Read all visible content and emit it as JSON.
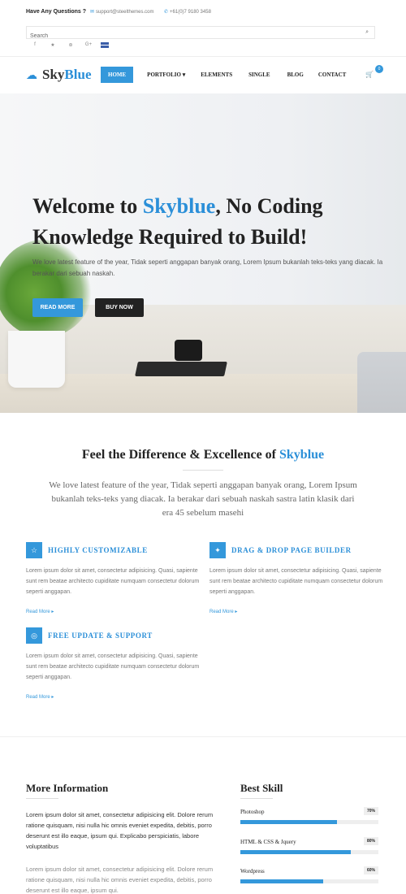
{
  "topbar": {
    "question": "Have Any Questions ?",
    "email": "support@steelthemes.com",
    "phone": "+61(0)7 9180 3458"
  },
  "search": {
    "placeholder": "Search"
  },
  "social": [
    {
      "icon": "facebook-icon",
      "glyph": "f"
    },
    {
      "icon": "twitter-icon",
      "glyph": "★"
    },
    {
      "icon": "pinterest-icon",
      "glyph": "⊛"
    },
    {
      "icon": "google-plus-icon",
      "glyph": "G+"
    }
  ],
  "logo": {
    "part1": "Sky",
    "part2": "Blue"
  },
  "nav": {
    "items": [
      "HOME",
      "PORTFOLIO",
      "ELEMENTS",
      "SINGLE",
      "BLOG",
      "CONTACT"
    ],
    "portfolio_caret": "▾",
    "cart_count": "0"
  },
  "hero": {
    "title_pre": "Welcome to ",
    "title_highlight": "Skyblue",
    "title_post": ", No Coding Knowledge Required to Build!",
    "text": "We love latest feature of the year, Tidak seperti anggapan banyak orang, Lorem Ipsum bukanlah teks-teks yang diacak. Ia berakar dari sebuah naskah.",
    "btn_primary": "READ MORE",
    "btn_secondary": "BUY NOW"
  },
  "features_intro": {
    "title_pre": "Feel the Difference & Excellence of ",
    "title_highlight": "Skyblue",
    "text": "We love latest feature of the year, Tidak seperti anggapan banyak orang, Lorem Ipsum bukanlah teks-teks yang diacak. Ia berakar dari sebuah naskah sastra latin klasik dari era 45 sebelum masehi"
  },
  "features": [
    {
      "icon": "lightbulb-icon",
      "glyph": "☆",
      "title": "HIGHLY CUSTOMIZABLE",
      "text": "Lorem ipsum dolor sit amet, consectetur adipisicing. Quasi, sapiente sunt rem beatae architecto cupiditate numquam consectetur dolorum seperti anggapan.",
      "more": "Read More"
    },
    {
      "icon": "drag-drop-icon",
      "glyph": "✦",
      "title": "DRAG & DROP PAGE BUILDER",
      "text": "Lorem ipsum dolor sit amet, consectetur adipisicing. Quasi, sapiente sunt rem beatae architecto cupiditate numquam consectetur dolorum seperti anggapan.",
      "more": "Read More"
    },
    {
      "icon": "globe-icon",
      "glyph": "◎",
      "title": "FREE UPDATE & SUPPORT",
      "text": "Lorem ipsum dolor sit amet, consectetur adipisicing. Quasi, sapiente sunt rem beatae architecto cupiditate numquam consectetur dolorum seperti anggapan.",
      "more": "Read More"
    }
  ],
  "more_info": {
    "title": "More Information",
    "p1": "Lorem ipsum dolor sit amet, consectetur adipisicing elit. Dolore rerum ratione quisquam, nisi nulla hic omnis eveniet expedita, debitis, porro deserunt est illo eaque, ipsum qui. Explicabo perspiciatis, labore voluptatibus",
    "p2": "Lorem ipsum dolor sit amet, consectetur adipisicing elit. Dolore rerum ratione quisquam, nisi nulla hic omnis eveniet expedita, debitis, porro deserunt est illo eaque, ipsum qui."
  },
  "skills": {
    "title": "Best Skill",
    "items": [
      {
        "name": "Photoshop",
        "percent_label": "70%",
        "percent": 70
      },
      {
        "name": "HTML & CSS & Jquery",
        "percent_label": "80%",
        "percent": 80
      },
      {
        "name": "Wordpress",
        "percent_label": "60%",
        "percent": 60
      }
    ]
  },
  "colors": {
    "accent": "#3498db",
    "dark": "#222222"
  }
}
